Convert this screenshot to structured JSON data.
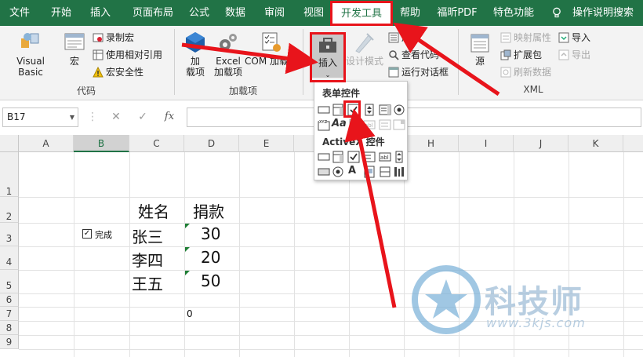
{
  "tabs": [
    {
      "label": "文件"
    },
    {
      "label": "开始"
    },
    {
      "label": "插入"
    },
    {
      "label": "页面布局"
    },
    {
      "label": "公式"
    },
    {
      "label": "数据"
    },
    {
      "label": "审阅"
    },
    {
      "label": "视图"
    },
    {
      "label": "开发工具",
      "active": true
    },
    {
      "label": "帮助"
    },
    {
      "label": "福昕PDF"
    },
    {
      "label": "特色功能"
    },
    {
      "label": "操作说明搜索"
    }
  ],
  "ribbon": {
    "code_group": {
      "label": "代码",
      "visual_basic": "Visual Basic",
      "macro": "宏",
      "record_macro": "录制宏",
      "relative_ref": "使用相对引用",
      "macro_security": "宏安全性"
    },
    "addins_group": {
      "label": "加载项",
      "addins_line1": "加",
      "addins_line2": "载项",
      "excel_addins_line1": "Excel",
      "excel_addins_line2": "加载项",
      "com_addins": "COM 加载项"
    },
    "controls_group": {
      "insert": "插入",
      "design_mode": "设计模式",
      "properties": "属性",
      "view_code": "查看代码",
      "run_dialog": "运行对话框"
    },
    "xml_group": {
      "label": "XML",
      "source": "源",
      "map_properties": "映射属性",
      "expansion_packs": "扩展包",
      "refresh_data": "刷新数据",
      "import": "导入",
      "export": "导出"
    }
  },
  "palette": {
    "form_controls_title": "表单控件",
    "activex_title": "ActiveX 控件"
  },
  "formula_bar": {
    "name_box": "B17",
    "cancel": "✕",
    "enter": "✓",
    "fx": "fx"
  },
  "grid": {
    "columns": [
      "A",
      "B",
      "C",
      "D",
      "E",
      "F",
      "G",
      "H",
      "I",
      "J",
      "K"
    ],
    "selected_column": "B",
    "rows": [
      "1",
      "2",
      "3",
      "4",
      "5",
      "6",
      "7",
      "8",
      "9"
    ],
    "header_name": "姓名",
    "header_amount": "捐款",
    "names": [
      "张三",
      "李四",
      "王五"
    ],
    "amounts": [
      "30",
      "20",
      "50"
    ],
    "d7_value": "0",
    "checkbox_label": "完成"
  },
  "watermark": {
    "brand": "科技师",
    "url": "www.3kjs.com"
  },
  "colors": {
    "excel_green": "#217346",
    "annotation_red": "#e8141b"
  }
}
